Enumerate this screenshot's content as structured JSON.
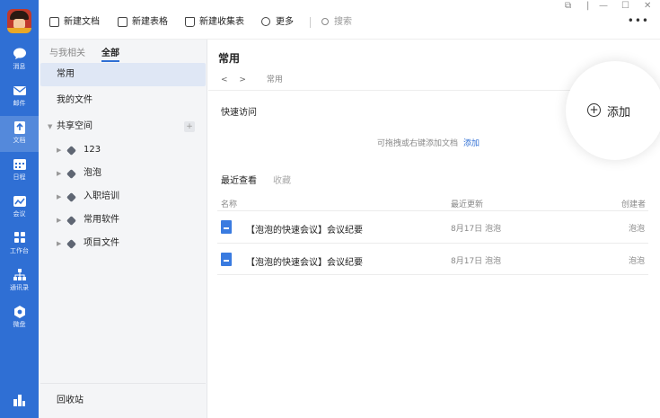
{
  "rail": {
    "items": [
      {
        "label": "消息",
        "icon": "chat-icon"
      },
      {
        "label": "邮件",
        "icon": "mail-icon"
      },
      {
        "label": "文档",
        "icon": "doc-icon"
      },
      {
        "label": "日程",
        "icon": "calendar-icon"
      },
      {
        "label": "会议",
        "icon": "meeting-icon"
      },
      {
        "label": "工作台",
        "icon": "apps-icon"
      },
      {
        "label": "通讯录",
        "icon": "contacts-icon"
      },
      {
        "label": "微盘",
        "icon": "drive-icon"
      }
    ],
    "accent": "#2f6fd4"
  },
  "toolbar": {
    "new_doc": "新建文档",
    "new_sheet": "新建表格",
    "new_form": "新建收集表",
    "more": "更多",
    "search_placeholder": "搜索"
  },
  "sidebar": {
    "tab_related": "与我相关",
    "tab_all": "全部",
    "common": "常用",
    "my_files": "我的文件",
    "shared_space": "共享空间",
    "folders": [
      "123",
      "泡泡",
      "入职培训",
      "常用软件",
      "项目文件"
    ],
    "recycle": "回收站"
  },
  "main": {
    "title": "常用",
    "crumb": "常用",
    "quick_access": "快速访问",
    "hint": "可拖拽或右键添加文档",
    "hint_link": "添加",
    "tab_recent": "最近查看",
    "tab_fav": "收藏",
    "col_name": "名称",
    "col_updated": "最近更新",
    "col_creator": "创建者",
    "rows": [
      {
        "name": "【泡泡的快速会议】会议纪要",
        "updated": "8月17日 泡泡",
        "creator": "泡泡"
      },
      {
        "name": "【泡泡的快速会议】会议纪要",
        "updated": "8月17日 泡泡",
        "creator": "泡泡"
      }
    ]
  },
  "bubble": {
    "label": "添加"
  }
}
